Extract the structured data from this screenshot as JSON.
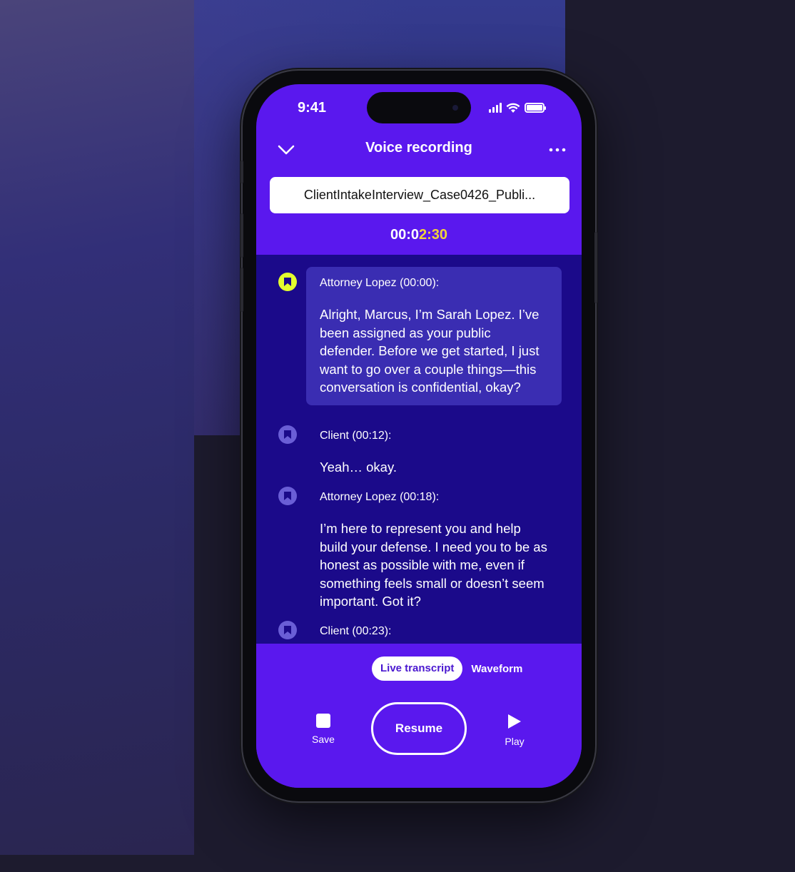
{
  "status_bar": {
    "time": "9:41"
  },
  "header": {
    "title": "Voice recording"
  },
  "recording": {
    "filename": "ClientIntakeInterview_Case0426_Publi...",
    "timer_prefix": "00:0",
    "timer_highlight": "2:30"
  },
  "transcript": {
    "entries": [
      {
        "speaker": "Attorney Lopez (00:00):",
        "text": "Alright, Marcus, I’m Sarah Lopez. I’ve been assigned as your public defender. Before we get started, I just want to go over a couple things—this conversation is confidential, okay?",
        "bookmarked": true
      },
      {
        "speaker": "Client (00:12):",
        "text": "Yeah… okay.",
        "bookmarked": false
      },
      {
        "speaker": "Attorney Lopez (00:18):",
        "text": "I’m here to represent you and help build your defense. I need you to be as honest as possible with me, even if something feels small or doesn’t seem important. Got it?",
        "bookmarked": false
      },
      {
        "speaker": "Client (00:23):",
        "text": "",
        "bookmarked": false
      }
    ]
  },
  "view_toggle": {
    "active": "Live transcript",
    "inactive": "Waveform"
  },
  "controls": {
    "save": "Save",
    "resume": "Resume",
    "play": "Play"
  },
  "colors": {
    "accent": "#5a18ee",
    "transcript_bg": "#1b0a8a",
    "bookmark_active": "#e4ff2e",
    "timer_highlight": "#f0d53a"
  }
}
